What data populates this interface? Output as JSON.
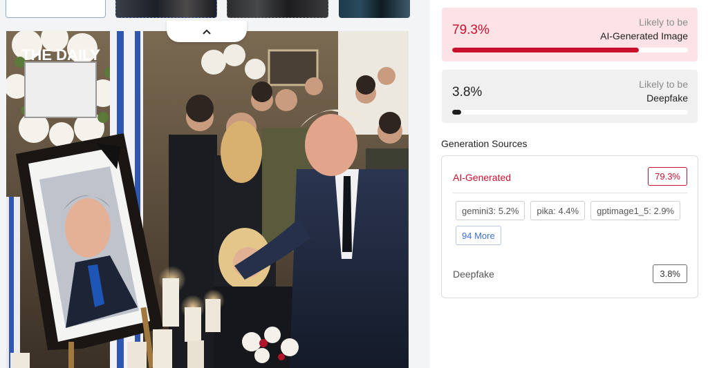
{
  "thumbnails": [
    {
      "name": "upload-slot"
    },
    {
      "name": "thumb-1"
    },
    {
      "name": "thumb-2"
    },
    {
      "name": "thumb-3"
    }
  ],
  "photo": {
    "watermark": "THE DAILY",
    "icon": "chevron-up-icon"
  },
  "ai_card": {
    "percent": "79.3%",
    "likely_label": "Likely to be",
    "kind_label": "AI-Generated Image",
    "progress": 0.793,
    "color": "#c8102e"
  },
  "deepfake_card": {
    "percent": "3.8%",
    "likely_label": "Likely to be",
    "kind_label": "Deepfake",
    "progress": 0.038,
    "color": "#1f1f1f"
  },
  "generation_sources": {
    "title": "Generation Sources",
    "ai": {
      "label": "AI-Generated",
      "percent": "79.3%"
    },
    "chips": [
      "gemini3: 5.2%",
      "pika: 4.4%",
      "gptimage1_5: 2.9%"
    ],
    "more_label": "94 More",
    "deepfake": {
      "label": "Deepfake",
      "percent": "3.8%"
    }
  }
}
